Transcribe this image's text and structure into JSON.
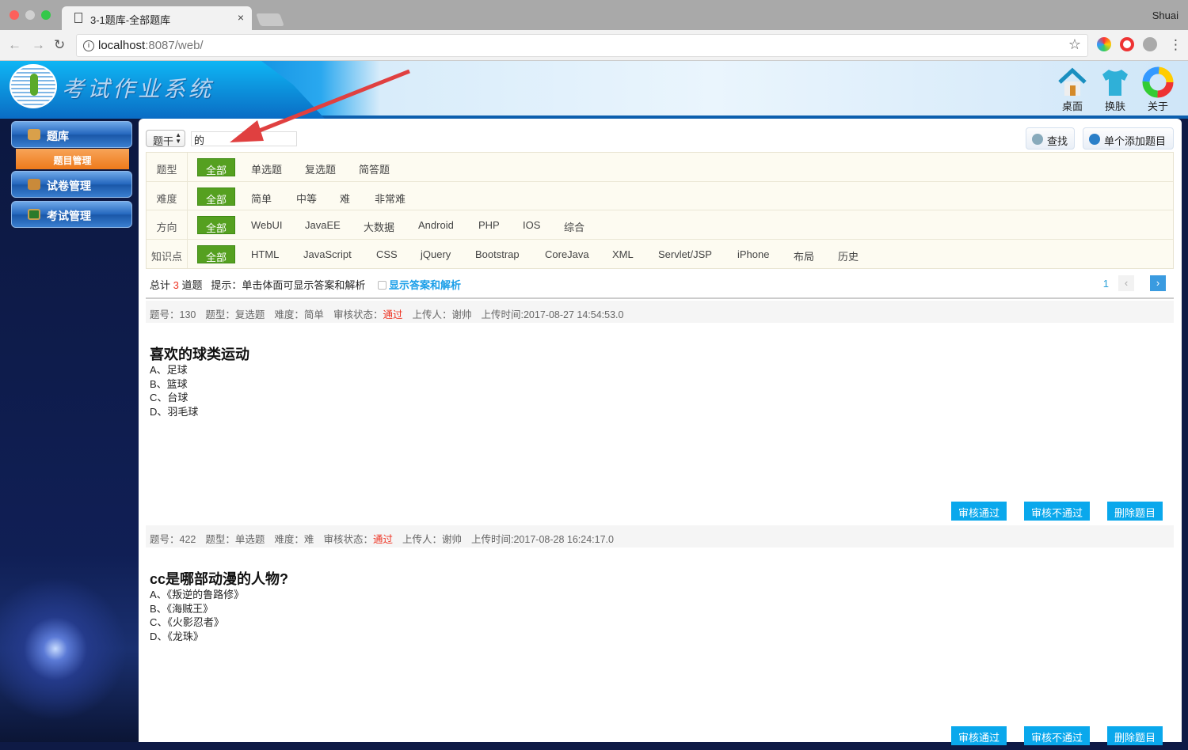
{
  "browser": {
    "tab_title": "3-1题库-全部题库",
    "url_host": "localhost",
    "url_rest": ":8087/web/",
    "user": "Shuai"
  },
  "header": {
    "title": "考试作业系统",
    "icons": [
      {
        "label": "桌面",
        "icon": "house-icon"
      },
      {
        "label": "换肤",
        "icon": "tshirt-icon"
      },
      {
        "label": "关于",
        "icon": "color-ring-icon"
      }
    ]
  },
  "sidebar": {
    "items": [
      {
        "label": "题库",
        "icon": "house-icon"
      },
      {
        "label": "试卷管理",
        "icon": "users-icon"
      },
      {
        "label": "考试管理",
        "icon": "screen-icon"
      }
    ],
    "sub_item": "题目管理"
  },
  "search": {
    "field": "题干",
    "keyword": "的",
    "find_label": "查找",
    "add_label": "单个添加题目"
  },
  "filters": [
    {
      "label": "题型",
      "all": "全部",
      "options": [
        "单选题",
        "复选题",
        "简答题"
      ]
    },
    {
      "label": "难度",
      "all": "全部",
      "options": [
        "简单",
        "中等",
        "难",
        "非常难"
      ]
    },
    {
      "label": "方向",
      "all": "全部",
      "options": [
        "WebUI",
        "JavaEE",
        "大数据",
        "Android",
        "PHP",
        "IOS",
        "综合"
      ]
    },
    {
      "label": "知识点",
      "all": "全部",
      "options": [
        "HTML",
        "JavaScript",
        "CSS",
        "jQuery",
        "Bootstrap",
        "CoreJava",
        "XML",
        "Servlet/JSP",
        "iPhone",
        "布局",
        "历史"
      ]
    }
  ],
  "summary": {
    "prefix": "总计",
    "count": "3",
    "suffix": "道题",
    "hint": "提示：单击体面可显示答案和解析",
    "toggle": "显示答案和解析"
  },
  "pager": {
    "page": "1",
    "prev": "‹",
    "next": "›"
  },
  "questions": [
    {
      "id_label": "题号：",
      "id": "130",
      "type_label": "题型：",
      "type": "复选题",
      "diff_label": "难度：",
      "diff": "简单",
      "status_label": "审核状态：",
      "status": "通过",
      "up_label": "上传人：",
      "uploader": "谢帅",
      "time_label": "上传时间:",
      "time": "2017-08-27 14:54:53.0",
      "title": "喜欢的球类运动",
      "options": [
        "A、足球",
        "B、篮球",
        "C、台球",
        "D、羽毛球"
      ]
    },
    {
      "id_label": "题号：",
      "id": "422",
      "type_label": "题型：",
      "type": "单选题",
      "diff_label": "难度：",
      "diff": "难",
      "status_label": "审核状态：",
      "status": "通过",
      "up_label": "上传人：",
      "uploader": "谢帅",
      "time_label": "上传时间:",
      "time": "2017-08-28 16:24:17.0",
      "title": "cc是哪部动漫的人物?",
      "options": [
        "A、《叛逆的鲁路修》",
        "B、《海贼王》",
        "C、《火影忍者》",
        "D、《龙珠》"
      ]
    }
  ],
  "actions": [
    "审核通过",
    "审核不通过",
    "删除题目"
  ],
  "colors": {
    "accent_green": "#55a020",
    "action_blue": "#0aa8ec",
    "status_red": "#e33322",
    "sub_menu_orange": "#ee7a1b"
  }
}
